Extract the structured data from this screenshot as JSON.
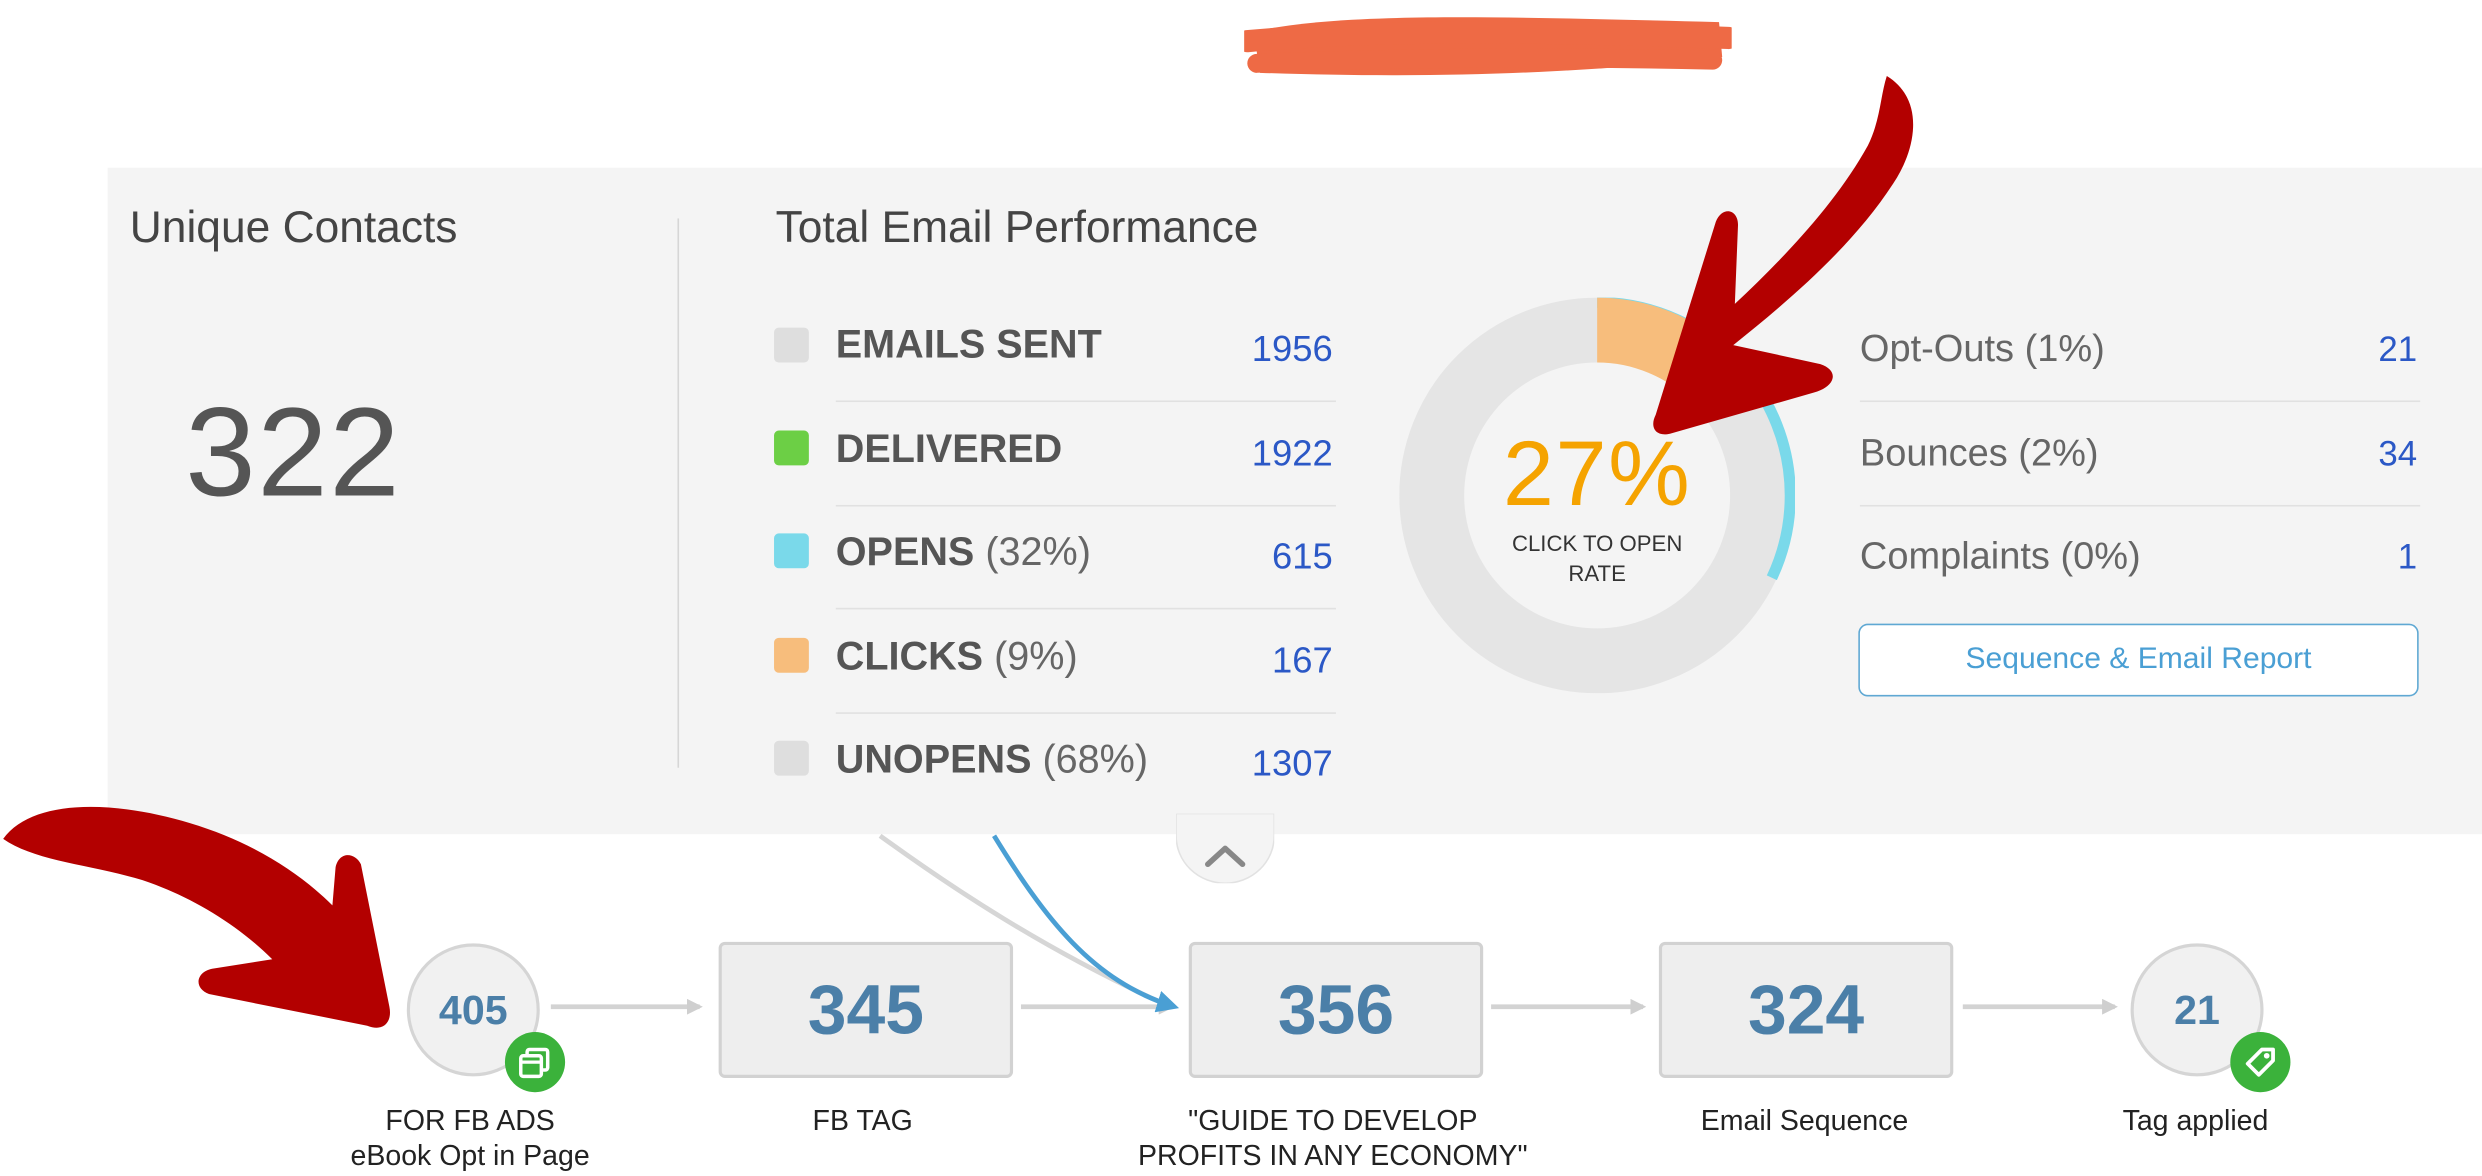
{
  "unique_contacts": {
    "title": "Unique Contacts",
    "value": "322"
  },
  "performance": {
    "title": "Total Email Performance",
    "metrics": [
      {
        "label": "EMAILS SENT",
        "pct": "",
        "value": "1956",
        "color": "#dedede"
      },
      {
        "label": "DELIVERED",
        "pct": "",
        "value": "1922",
        "color": "#6ccf45"
      },
      {
        "label": "OPENS",
        "pct": "(32%)",
        "value": "615",
        "color": "#7ad9ea"
      },
      {
        "label": "CLICKS",
        "pct": "(9%)",
        "value": "167",
        "color": "#f7bd7c"
      },
      {
        "label": "UNOPENS",
        "pct": "(68%)",
        "value": "1307",
        "color": "#dedede"
      }
    ]
  },
  "donut": {
    "value": "27%",
    "caption_line1": "CLICK TO OPEN",
    "caption_line2": "RATE",
    "clicks_fraction": 0.09,
    "opens_fraction": 0.32,
    "colors": {
      "track": "#e5e5e5",
      "clicks": "#f7bd7c",
      "opens": "#7ad9ea",
      "value_text": "#f5a300"
    }
  },
  "side_stats": [
    {
      "label": "Opt-Outs (1%)",
      "value": "21"
    },
    {
      "label": "Bounces (2%)",
      "value": "34"
    },
    {
      "label": "Complaints (0%)",
      "value": "1"
    }
  ],
  "report_button": {
    "label": "Sequence & Email Report"
  },
  "flow": {
    "nodes": [
      {
        "count": "405",
        "label_line1": "FOR FB ADS",
        "label_line2": "eBook Opt in Page",
        "icon": "page-icon"
      },
      {
        "count": "345",
        "label_line1": "FB TAG",
        "label_line2": ""
      },
      {
        "count": "356",
        "label_line1": "\"GUIDE TO DEVELOP",
        "label_line2": "PROFITS IN ANY ECONOMY\""
      },
      {
        "count": "324",
        "label_line1": "Email Sequence",
        "label_line2": ""
      },
      {
        "count": "21",
        "label_line1": "Tag applied",
        "label_line2": "",
        "icon": "tag-icon"
      }
    ]
  },
  "colors": {
    "accent_blue": "#2b58c6",
    "flow_number": "#4b7fa8",
    "badge_green": "#3bb23b",
    "annotation_red": "#b30000",
    "redaction_orange": "#ee6a45"
  }
}
